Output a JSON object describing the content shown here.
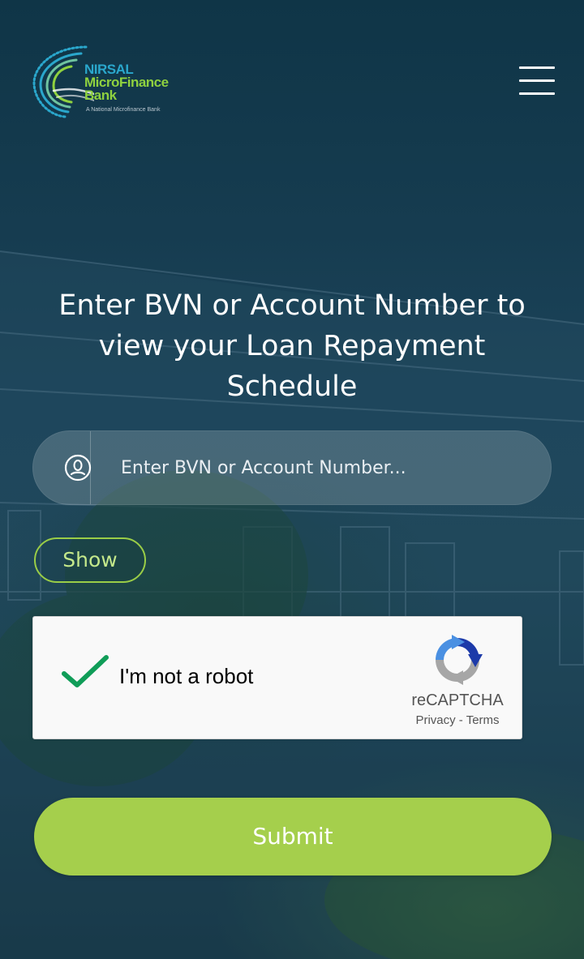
{
  "header": {
    "logo": {
      "line1": "NIRSAL",
      "line2": "MicroFinance",
      "line3": "Bank",
      "tagline": "A National Microfinance Bank",
      "icon": "nirsal-swirl-logo"
    },
    "menu_icon": "hamburger-menu-icon"
  },
  "main": {
    "heading": "Enter BVN or Account Number to view your Loan Repayment Schedule",
    "search": {
      "icon": "user-icon",
      "value": "",
      "placeholder": "Enter BVN or Account Number..."
    },
    "show_label": "Show",
    "recaptcha": {
      "checked": true,
      "label": "I'm not a robot",
      "brand": "reCAPTCHA",
      "privacy_label": "Privacy",
      "separator": "-",
      "terms_label": "Terms",
      "icon": "recaptcha-logo-icon"
    },
    "submit_label": "Submit"
  },
  "colors": {
    "accent": "#a5cf4c",
    "show_border": "#9acd47",
    "background": "#1b4359",
    "check": "#109d58"
  }
}
